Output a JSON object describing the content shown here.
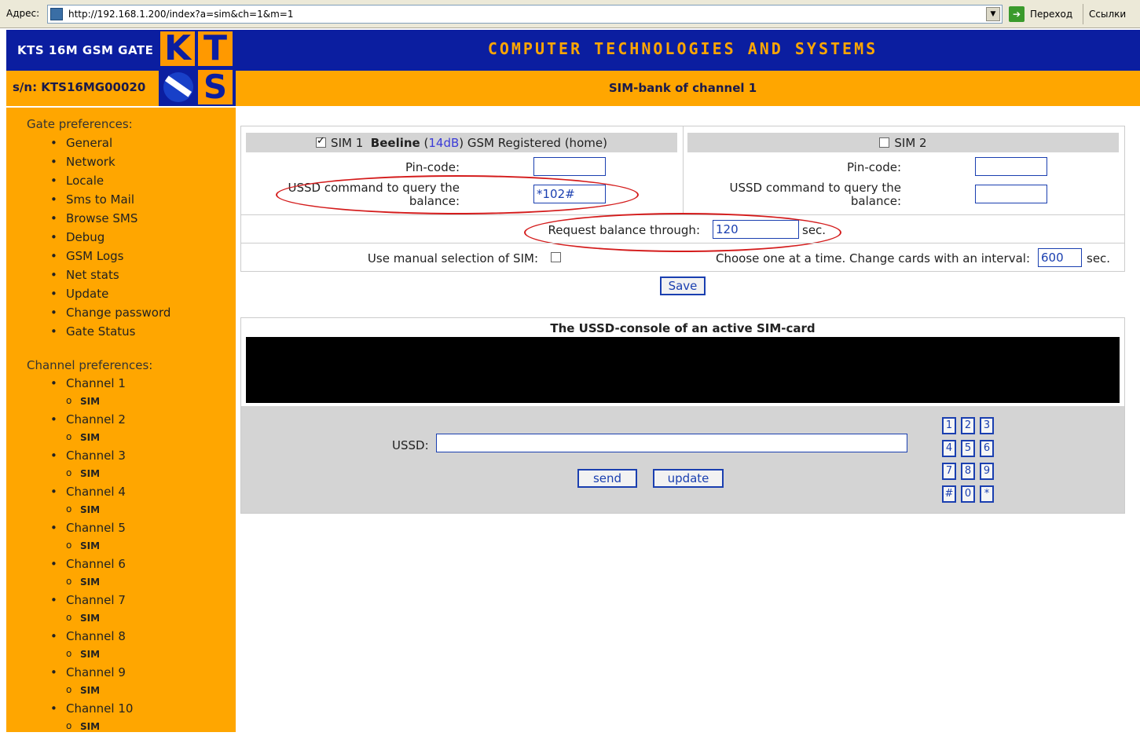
{
  "browser": {
    "address_label": "Адрес:",
    "url": "http://192.168.1.200/index?a=sim&ch=1&m=1",
    "go_label": "Переход",
    "links_label": "Ссылки"
  },
  "header": {
    "brand": "KTS 16M GSM GATE",
    "logo_letters": [
      "K",
      "T",
      "S"
    ],
    "banner": "COMPUTER TECHNOLOGIES AND SYSTEMS",
    "serial": "s/n: KTS16MG00020",
    "subtitle": "SIM-bank of channel 1"
  },
  "sidebar": {
    "gate_heading": "Gate preferences:",
    "gate_items": [
      "General",
      "Network",
      "Locale",
      "Sms to Mail",
      "Browse SMS",
      "Debug",
      "GSM Logs",
      "Net stats",
      "Update",
      "Change password",
      "Gate Status"
    ],
    "channel_heading": "Channel preferences:",
    "channels": [
      {
        "label": "Channel 1",
        "sub": "SIM"
      },
      {
        "label": "Channel 2",
        "sub": "SIM"
      },
      {
        "label": "Channel 3",
        "sub": "SIM"
      },
      {
        "label": "Channel 4",
        "sub": "SIM"
      },
      {
        "label": "Channel 5",
        "sub": "SIM"
      },
      {
        "label": "Channel 6",
        "sub": "SIM"
      },
      {
        "label": "Channel 7",
        "sub": "SIM"
      },
      {
        "label": "Channel 8",
        "sub": "SIM"
      },
      {
        "label": "Channel 9",
        "sub": "SIM"
      },
      {
        "label": "Channel 10",
        "sub": "SIM"
      }
    ]
  },
  "sim1": {
    "checked": true,
    "title": "SIM 1",
    "operator": "Beeline",
    "signal_open": "(",
    "signal": "14dB",
    "signal_close": ")",
    "status": "GSM Registered (home)",
    "pin_label": "Pin-code:",
    "pin_value": "",
    "ussd_label_1": "USSD command to query the",
    "ussd_label_2": "balance:",
    "ussd_value": "*102#"
  },
  "sim2": {
    "checked": false,
    "title": "SIM 2",
    "pin_label": "Pin-code:",
    "pin_value": "",
    "ussd_label_1": "USSD command to query the",
    "ussd_label_2": "balance:",
    "ussd_value": ""
  },
  "request": {
    "label": "Request balance through:",
    "value": "120",
    "unit": "sec."
  },
  "manual": {
    "label": "Use manual selection of SIM:",
    "checked": false
  },
  "interval": {
    "label": "Choose one at a time. Change cards with an interval:",
    "value": "600",
    "unit": "sec."
  },
  "save_label": "Save",
  "console": {
    "title": "The USSD-console of an active SIM-card",
    "ussd_label": "USSD:",
    "ussd_value": "",
    "send_label": "send",
    "update_label": "update",
    "keys": [
      "1",
      "2",
      "3",
      "4",
      "5",
      "6",
      "7",
      "8",
      "9",
      "#",
      "0",
      "*"
    ]
  },
  "colors": {
    "header_blue": "#0b1ea0",
    "accent_orange": "#ffa600",
    "annotation_red": "#d41c1c",
    "link_blue": "#3b3bd8"
  }
}
